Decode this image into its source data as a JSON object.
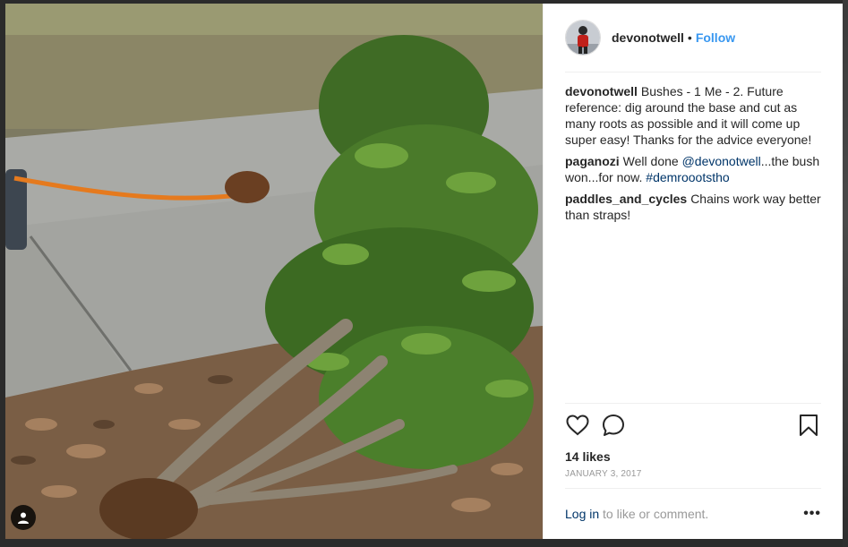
{
  "post": {
    "username": "devonotwell",
    "separator": "•",
    "follow_label": "Follow",
    "comments": [
      {
        "user": "devonotwell",
        "text": "Bushes - 1 Me - 2. Future reference: dig around the base and cut as many roots as possible and it will come up super easy! Thanks for the advice everyone!"
      },
      {
        "user": "paganozi",
        "text_before": "Well done ",
        "mention": "@devonotwell",
        "text_middle": "...the bush won...for now. ",
        "hashtag": "#demroootstho"
      },
      {
        "user": "paddles_and_cycles",
        "text": "Chains work way better than straps!"
      }
    ],
    "likes": "14 likes",
    "date": "JANUARY 3, 2017",
    "login_link": "Log in",
    "login_suffix": " to like or comment.",
    "more_label": "•••"
  },
  "icons": {
    "like": "heart-icon",
    "comment": "comment-icon",
    "save": "bookmark-icon",
    "user_tag": "user-tag-icon"
  },
  "colors": {
    "accent": "#3897f0",
    "link": "#003569",
    "text": "#262626",
    "muted": "#999999"
  }
}
